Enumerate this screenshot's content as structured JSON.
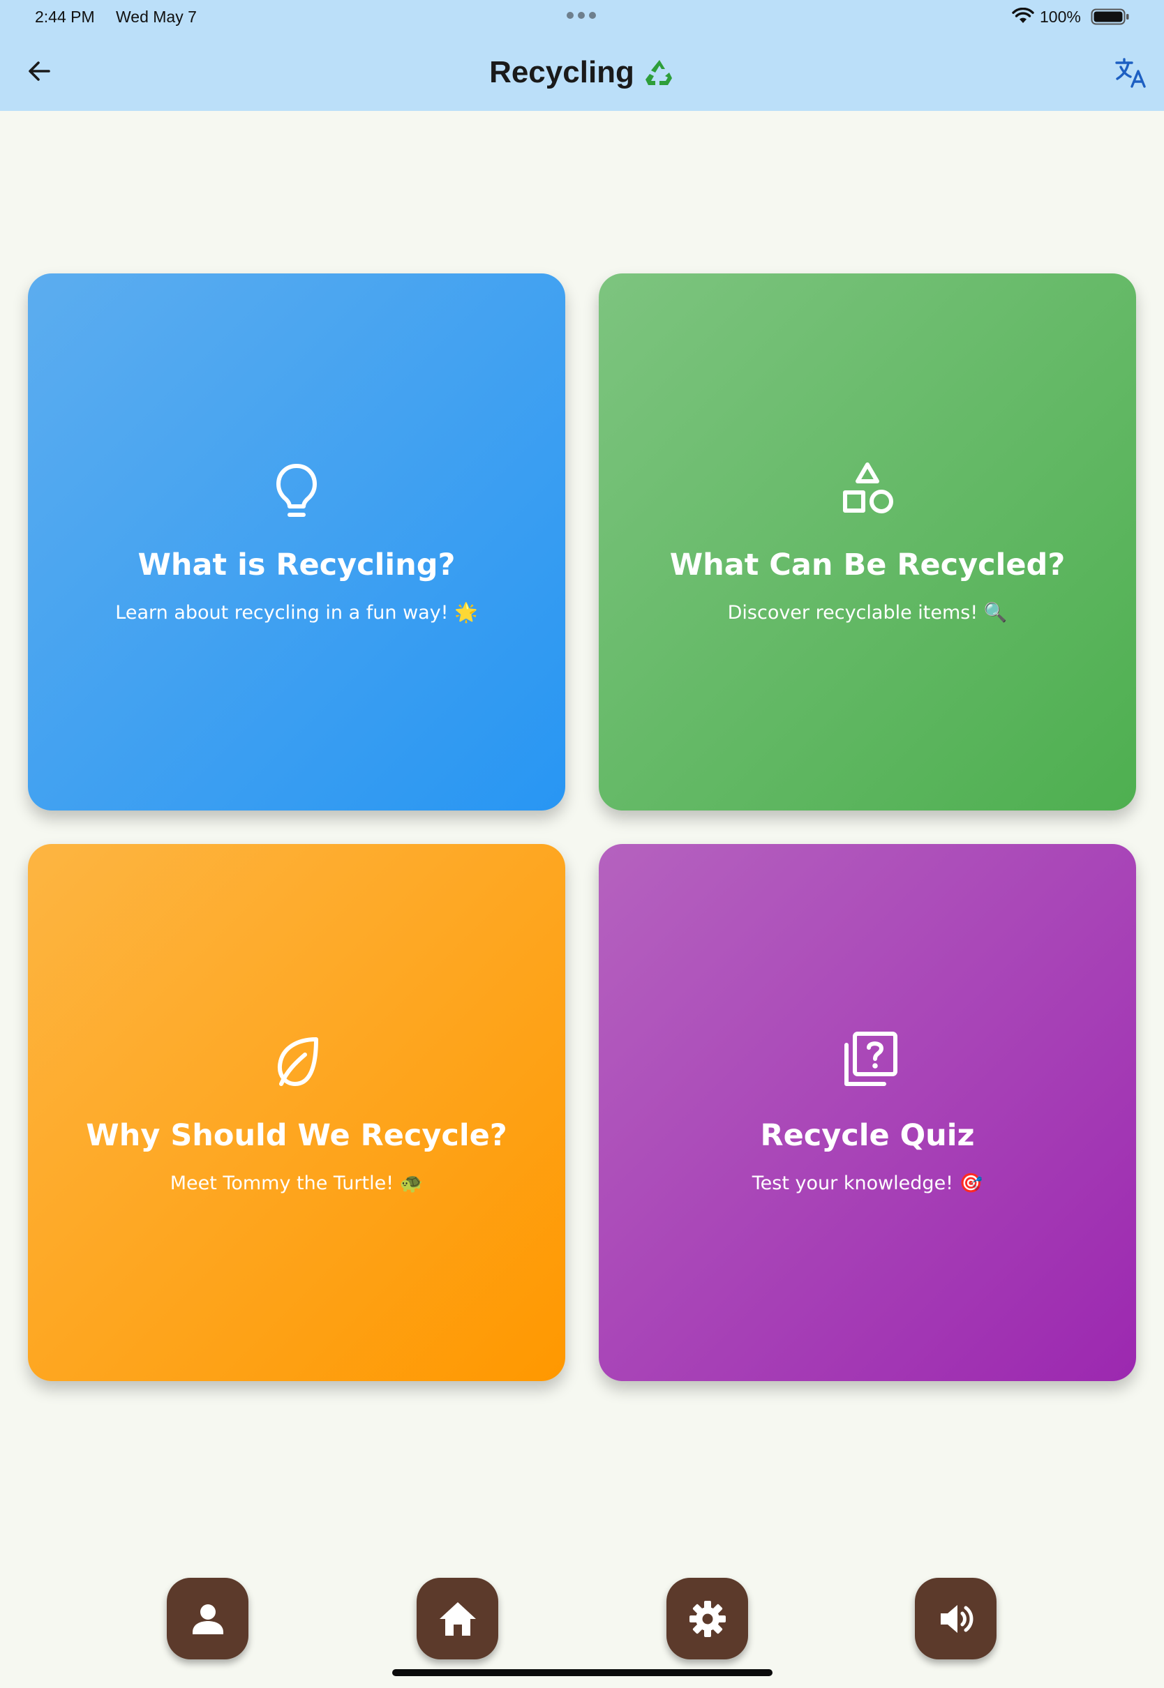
{
  "status_bar": {
    "time": "2:44 PM",
    "date": "Wed May 7",
    "battery_percent": "100%",
    "icons": [
      "more-dots-icon",
      "wifi-icon",
      "battery-icon"
    ]
  },
  "app_bar": {
    "title": "Recycling",
    "title_emoji": "recycle-icon",
    "back_icon": "arrow-left-icon",
    "action_icon": "translate-icon"
  },
  "cards": [
    {
      "title": "What is Recycling?",
      "subtitle": "Learn about recycling in a fun way! 🌟",
      "icon": "lightbulb-icon",
      "color": "#2896f3"
    },
    {
      "title": "What Can Be Recycled?",
      "subtitle": "Discover recyclable items! 🔍",
      "icon": "shapes-icon",
      "color": "#4eaf50"
    },
    {
      "title": "Why Should We Recycle?",
      "subtitle": "Meet Tommy the Turtle! 🐢",
      "icon": "leaf-icon",
      "color": "#ff9800"
    },
    {
      "title": "Recycle Quiz",
      "subtitle": "Test your knowledge! 🎯",
      "icon": "quiz-icon",
      "color": "#9c28b0"
    }
  ],
  "bottom_nav": [
    {
      "icon": "person-icon"
    },
    {
      "icon": "home-icon"
    },
    {
      "icon": "gear-icon"
    },
    {
      "icon": "volume-icon"
    }
  ],
  "colors": {
    "header_bg": "#bbdff9",
    "page_bg": "#f6f8f1",
    "nav_button_bg": "#5c3a2b"
  }
}
